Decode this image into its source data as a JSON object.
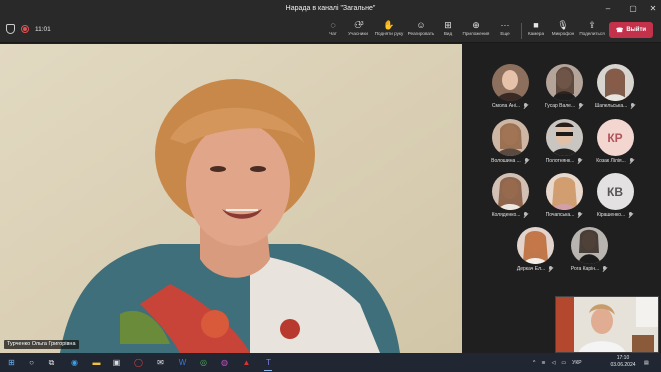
{
  "window": {
    "title": "Нарада в каналі \"Загальне\""
  },
  "toolbar": {
    "time": "11:01",
    "chat": "Чат",
    "participants": "Учасники",
    "participants_count": "13",
    "raise_hand": "Подняти руку",
    "react": "Реагировать",
    "view": "Вид",
    "apps": "Приложения",
    "more": "Еще",
    "camera": "Камера",
    "mic": "Микрофон",
    "share": "Поделиться",
    "leave": "Выйти"
  },
  "main": {
    "speaker_name": "Турченко Ольга Григорівна"
  },
  "participants": [
    {
      "name": "Смола Ані..."
    },
    {
      "name": "Гусар Вале..."
    },
    {
      "name": "Шапельська..."
    },
    {
      "name": "Волошина ..."
    },
    {
      "name": "Полотнянк..."
    },
    {
      "name": "Козак Лілія...",
      "initials": "КР"
    },
    {
      "name": "Коляденко..."
    },
    {
      "name": "Почапська..."
    },
    {
      "name": "Кірашенко...",
      "initials": "КВ"
    },
    {
      "name": "Деркач Ел..."
    },
    {
      "name": "Рога Карін..."
    }
  ],
  "taskbar": {
    "language": "УКР",
    "clock_time": "17:10",
    "clock_date": "03.06.2024"
  },
  "colors": {
    "leave_button": "#c4314b",
    "toolbar_bg": "#292929",
    "panel_bg": "#1f1f1f",
    "taskbar_bg": "#202733"
  }
}
